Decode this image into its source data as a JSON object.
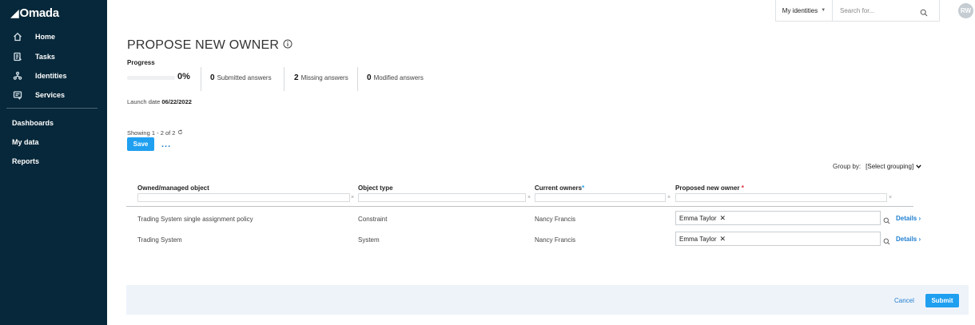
{
  "app": {
    "logo_text": "Omada"
  },
  "sidebar": {
    "items": [
      {
        "label": "Home",
        "icon": "home-icon"
      },
      {
        "label": "Tasks",
        "icon": "tasks-icon"
      },
      {
        "label": "Identities",
        "icon": "identities-icon"
      },
      {
        "label": "Services",
        "icon": "services-icon"
      }
    ],
    "links": [
      "Dashboards",
      "My data",
      "Reports"
    ]
  },
  "topbar": {
    "scope_label": "My identities",
    "search_placeholder": "Search for...",
    "avatar_initials": "RW"
  },
  "page": {
    "title": "PROPOSE NEW OWNER",
    "progress_label": "Progress",
    "progress_percent_text": "0%",
    "progress_fraction": 0,
    "stats": [
      {
        "count": "0",
        "label": "Submitted answers"
      },
      {
        "count": "2",
        "label": "Missing answers"
      },
      {
        "count": "0",
        "label": "Modified answers"
      }
    ],
    "launch_label": "Launch date",
    "launch_date": "06/22/2022",
    "showing_text": "Showing 1 - 2 of 2",
    "save_label": "Save",
    "more_label": "...",
    "group_by_label": "Group by:",
    "group_by_value": "[Select grouping]"
  },
  "table": {
    "columns": {
      "object": "Owned/managed object",
      "type": "Object type",
      "current": "Current owners",
      "proposed": "Proposed new owner"
    },
    "rows": [
      {
        "object": "Trading System single assignment policy",
        "type": "Constraint",
        "current": "Nancy Francis",
        "proposed": "Emma Taylor",
        "details": "Details"
      },
      {
        "object": "Trading System",
        "type": "System",
        "current": "Nancy Francis",
        "proposed": "Emma Taylor",
        "details": "Details"
      }
    ]
  },
  "footer": {
    "cancel_label": "Cancel",
    "submit_label": "Submit"
  },
  "colors": {
    "sidebar_bg": "#07283a",
    "accent": "#1f9ff0",
    "link": "#1f7fd0",
    "required": "#d9263a",
    "footer_bg": "#eef3fa"
  }
}
